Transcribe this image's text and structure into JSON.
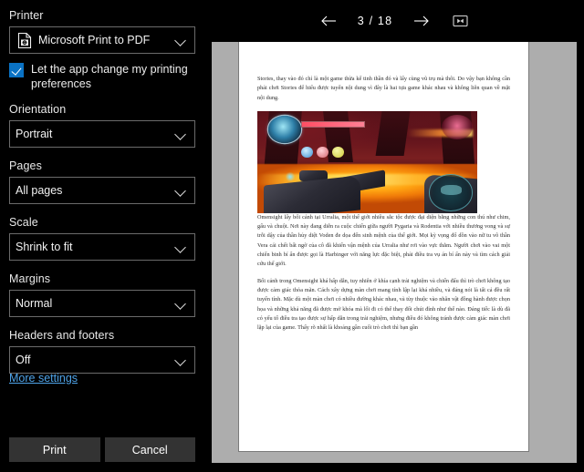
{
  "settings": {
    "printer": {
      "label": "Printer",
      "value": "Microsoft Print to PDF",
      "icon": "printer-icon"
    },
    "app_preferences": {
      "label": "Let the app change my printing preferences",
      "checked": true
    },
    "orientation": {
      "label": "Orientation",
      "value": "Portrait"
    },
    "pages": {
      "label": "Pages",
      "value": "All pages"
    },
    "scale": {
      "label": "Scale",
      "value": "Shrink to fit"
    },
    "margins": {
      "label": "Margins",
      "value": "Normal"
    },
    "headers_footers": {
      "label": "Headers and footers",
      "value": "Off"
    },
    "more_settings_link": "More settings",
    "print_button": "Print",
    "cancel_button": "Cancel",
    "accent_color": "#0a72c4",
    "link_color": "#4ea3e8",
    "button_color": "#333333"
  },
  "preview": {
    "toolbar": {
      "previous_icon": "arrow-left-icon",
      "next_icon": "arrow-right-icon",
      "fit_page_icon": "fit-to-page-icon",
      "page_indicator": "3 / 18",
      "current_page": 3,
      "total_pages": 18
    },
    "document": {
      "paragraphs": [
        "Stories, thay vào đó chỉ là một game thừa kế tinh thần đó và lấy cùng vũ trụ mà thôi. Do vậy bạn không cần phải chơi Stories để hiểu được tuyến nội dung vì đây là hai tựa game khác nhau và không liên quan về mặt nội dung.",
        "Omensight lấy bối cảnh tại Urralia, một thế giới nhiều sắc tộc được đại diện bằng những con thú như chim, gấu và chuột. Nơi này đang diễn ra cuộc chiến giữa người Pygaria và Rodentia với nhiều thương vong và sự trỗi dậy của thần hủy diệt Voden đe dọa đến sinh mệnh của thế giới. Mọi kỳ vọng đổ dồn vào nữ tu vô thần Vera cái chết bất ngờ của cô đã khiến vận mệnh của Urralia như rơi vào vực thẳm. Người chơi vào vai một chiến binh bí ẩn được gọi là Harbinger với năng lực đặc biệt, phải điều tra vụ án bí ẩn này và tìm cách giải cứu thế giới.",
        "Bối cảnh trong Omensight khá hấp dẫn, tuy nhiên ở khía cạnh trải nghiệm và chiến đấu thì trò chơi không tạo được cảm giác thỏa mãn. Cách xây dựng màn chơi mang tính lập lại khá nhiều, và đáng nói là tất cả đều rất tuyến tính. Mặc dù một màn chơi có nhiều đường khác nhau, và tùy thuộc vào nhân vật đồng hành được chọn họa và những khả năng đã được mở khóa mà lối đi có thể thay đổi chút đỉnh như thế nào. Đáng tiếc là dù đã có yếu tố điều tra tạo được sự hấp dẫn trong trải nghiệm, nhưng điều đó không tránh được cảm giác màn chơi lặp lại của game. Thấy rõ nhất là khoảng gần cuối trò chơi thì bạn gần"
      ],
      "figure_alt": "Omensight game screenshot with lava cavern and HUD"
    }
  }
}
